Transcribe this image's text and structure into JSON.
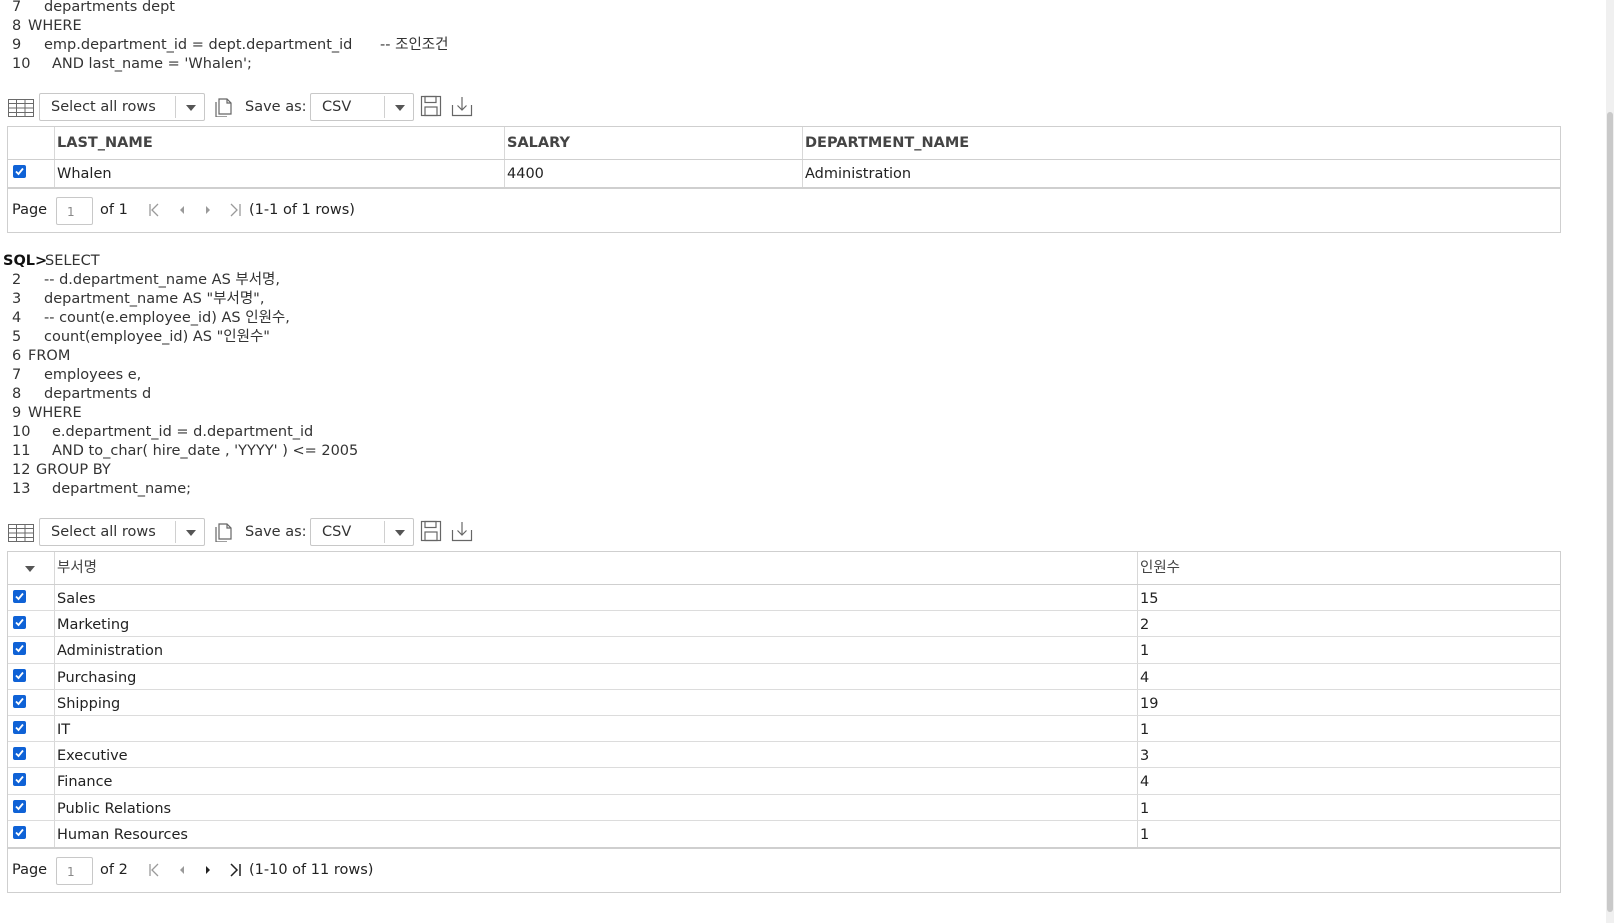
{
  "query1": {
    "lines": [
      {
        "num": "7",
        "indent": 44,
        "text": "departments dept"
      },
      {
        "num": "8",
        "indent": 28,
        "text": "WHERE"
      },
      {
        "num": "9",
        "indent": 44,
        "text": "emp.department_id = dept.department_id      -- 조인조건"
      },
      {
        "num": "10",
        "indent": 52,
        "text": "AND last_name = 'Whalen';"
      }
    ]
  },
  "result1": {
    "toolbar": {
      "select_label": "Select all rows",
      "save_as_label": "Save as:",
      "format": "CSV"
    },
    "columns": [
      "LAST_NAME",
      "SALARY",
      "DEPARTMENT_NAME"
    ],
    "rows": [
      [
        "Whalen",
        "4400",
        "Administration"
      ]
    ],
    "pager": {
      "page_label": "Page",
      "page_value": "1",
      "of_label": "of 1",
      "range": "(1-1 of 1 rows)"
    }
  },
  "query2": {
    "prompt": "SQL>",
    "first_line": "SELECT",
    "lines": [
      {
        "num": "2",
        "indent": 44,
        "text": "-- d.department_name AS 부서명,"
      },
      {
        "num": "3",
        "indent": 44,
        "text": "department_name AS \"부서명\","
      },
      {
        "num": "4",
        "indent": 44,
        "text": "-- count(e.employee_id) AS 인원수,"
      },
      {
        "num": "5",
        "indent": 44,
        "text": "count(employee_id) AS \"인원수\""
      },
      {
        "num": "6",
        "indent": 28,
        "text": "FROM"
      },
      {
        "num": "7",
        "indent": 44,
        "text": "employees e,"
      },
      {
        "num": "8",
        "indent": 44,
        "text": "departments d"
      },
      {
        "num": "9",
        "indent": 28,
        "text": "WHERE"
      },
      {
        "num": "10",
        "indent": 52,
        "text": "e.department_id = d.department_id"
      },
      {
        "num": "11",
        "indent": 52,
        "text": "AND to_char( hire_date , 'YYYY' ) <= 2005"
      },
      {
        "num": "12",
        "indent": 36,
        "text": "GROUP BY"
      },
      {
        "num": "13",
        "indent": 52,
        "text": "department_name;"
      }
    ]
  },
  "result2": {
    "toolbar": {
      "select_label": "Select all rows",
      "save_as_label": "Save as:",
      "format": "CSV"
    },
    "columns": [
      "부서명",
      "인원수"
    ],
    "rows": [
      [
        "Sales",
        "15"
      ],
      [
        "Marketing",
        "2"
      ],
      [
        "Administration",
        "1"
      ],
      [
        "Purchasing",
        "4"
      ],
      [
        "Shipping",
        "19"
      ],
      [
        "IT",
        "1"
      ],
      [
        "Executive",
        "3"
      ],
      [
        "Finance",
        "4"
      ],
      [
        "Public Relations",
        "1"
      ],
      [
        "Human Resources",
        "1"
      ]
    ],
    "pager": {
      "page_label": "Page",
      "page_value": "1",
      "of_label": "of 2",
      "range": "(1-10 of 11 rows)"
    }
  }
}
